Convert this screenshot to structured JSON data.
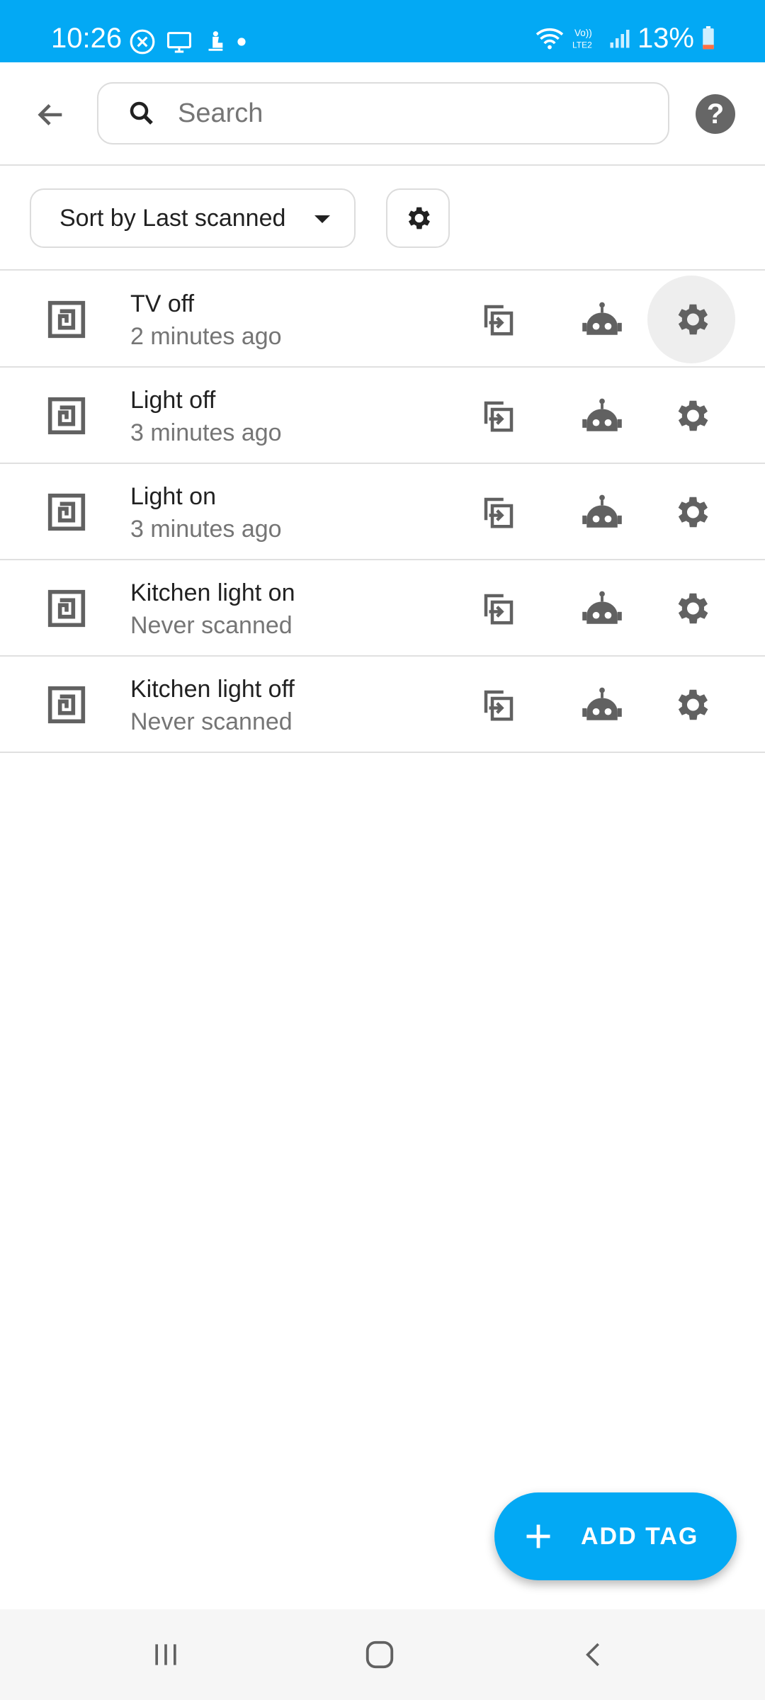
{
  "status_bar": {
    "time": "10:26",
    "battery_percent": "13%",
    "left_icons": [
      "cancel-circle-icon",
      "cast-screen-icon",
      "accessibility-icon",
      "dot-icon"
    ],
    "right_icons": [
      "wifi-icon",
      "volte-lte2-icon",
      "signal-icon",
      "battery-low-icon"
    ],
    "background_color": "#03a9f4"
  },
  "app_bar": {
    "back_icon": "arrow-back-icon",
    "search_placeholder": "Search",
    "search_value": "",
    "help_icon": "help-circle-icon",
    "help_glyph": "?"
  },
  "sort": {
    "label": "Sort by Last scanned",
    "settings_icon": "gear-icon"
  },
  "tags": [
    {
      "name": "TV off",
      "last_scanned": "2 minutes ago"
    },
    {
      "name": "Light off",
      "last_scanned": "3 minutes ago"
    },
    {
      "name": "Light on",
      "last_scanned": "3 minutes ago"
    },
    {
      "name": "Kitchen light on",
      "last_scanned": "Never scanned"
    },
    {
      "name": "Kitchen light off",
      "last_scanned": "Never scanned"
    }
  ],
  "row_actions": [
    "copy-to-icon",
    "robot-icon",
    "gear-icon"
  ],
  "fab": {
    "label": "ADD TAG",
    "icon": "plus-icon",
    "color": "#03a9f4"
  },
  "nav_bar": {
    "buttons": [
      "recents-icon",
      "home-icon",
      "back-chevron-icon"
    ]
  }
}
